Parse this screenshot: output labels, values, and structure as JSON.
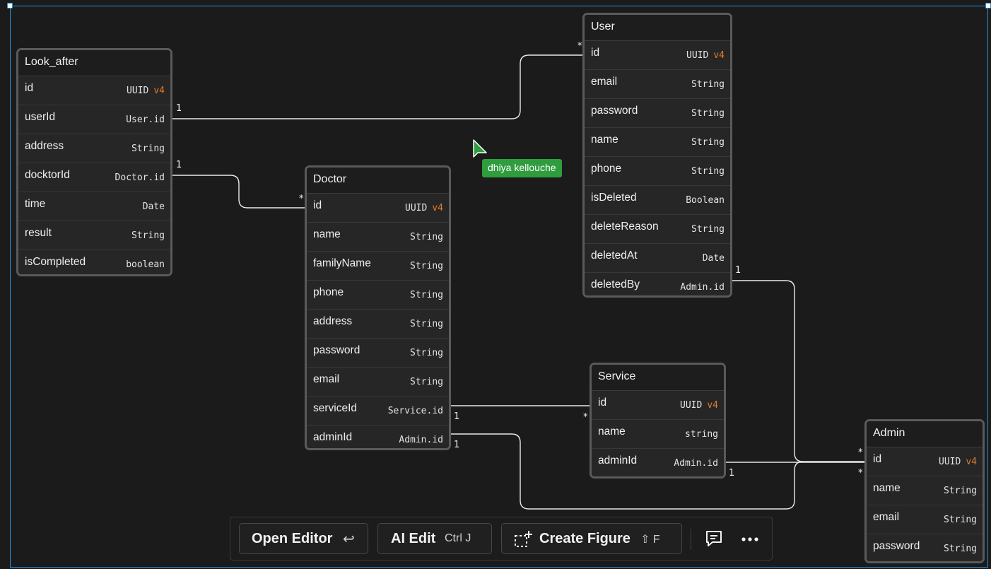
{
  "canvas": {
    "background": "#1b1b1b",
    "selection_color": "#2b8fd6",
    "wire_color": "#e9e9e9",
    "type_modifier_color": "#e07b2c"
  },
  "entities": {
    "look_after": {
      "title": "Look_after",
      "fields": [
        {
          "name": "id",
          "type": "UUID",
          "mod": "v4"
        },
        {
          "name": "userId",
          "type": "User.id",
          "mod": ""
        },
        {
          "name": "address",
          "type": "String",
          "mod": ""
        },
        {
          "name": "docktorId",
          "type": "Doctor.id",
          "mod": ""
        },
        {
          "name": "time",
          "type": "Date",
          "mod": ""
        },
        {
          "name": "result",
          "type": "String",
          "mod": ""
        },
        {
          "name": "isCompleted",
          "type": "boolean",
          "mod": ""
        }
      ]
    },
    "user": {
      "title": "User",
      "fields": [
        {
          "name": "id",
          "type": "UUID",
          "mod": "v4"
        },
        {
          "name": "email",
          "type": "String",
          "mod": ""
        },
        {
          "name": "password",
          "type": "String",
          "mod": ""
        },
        {
          "name": "name",
          "type": "String",
          "mod": ""
        },
        {
          "name": "phone",
          "type": "String",
          "mod": ""
        },
        {
          "name": "isDeleted",
          "type": "Boolean",
          "mod": ""
        },
        {
          "name": "deleteReason",
          "type": "String",
          "mod": ""
        },
        {
          "name": "deletedAt",
          "type": "Date",
          "mod": ""
        },
        {
          "name": "deletedBy",
          "type": "Admin.id",
          "mod": ""
        }
      ]
    },
    "doctor": {
      "title": "Doctor",
      "fields": [
        {
          "name": "id",
          "type": "UUID",
          "mod": "v4"
        },
        {
          "name": "name",
          "type": "String",
          "mod": ""
        },
        {
          "name": "familyName",
          "type": "String",
          "mod": ""
        },
        {
          "name": "phone",
          "type": "String",
          "mod": ""
        },
        {
          "name": "address",
          "type": "String",
          "mod": ""
        },
        {
          "name": "password",
          "type": "String",
          "mod": ""
        },
        {
          "name": "email",
          "type": "String",
          "mod": ""
        },
        {
          "name": "serviceId",
          "type": "Service.id",
          "mod": ""
        },
        {
          "name": "adminId",
          "type": "Admin.id",
          "mod": ""
        }
      ]
    },
    "service": {
      "title": "Service",
      "fields": [
        {
          "name": "id",
          "type": "UUID",
          "mod": "v4"
        },
        {
          "name": "name",
          "type": "string",
          "mod": ""
        },
        {
          "name": "adminId",
          "type": "Admin.id",
          "mod": ""
        }
      ]
    },
    "admin": {
      "title": "Admin",
      "fields": [
        {
          "name": "id",
          "type": "UUID",
          "mod": "v4"
        },
        {
          "name": "name",
          "type": "String",
          "mod": ""
        },
        {
          "name": "email",
          "type": "String",
          "mod": ""
        },
        {
          "name": "password",
          "type": "String",
          "mod": ""
        }
      ]
    }
  },
  "relations": [
    {
      "from": "Look_after.userId",
      "to": "User.id",
      "from_card": "1",
      "to_card": "*"
    },
    {
      "from": "Look_after.docktorId",
      "to": "Doctor.id",
      "from_card": "1",
      "to_card": "*"
    },
    {
      "from": "Doctor.serviceId",
      "to": "Service.id",
      "from_card": "1",
      "to_card": "*"
    },
    {
      "from": "Doctor.adminId",
      "to": "Admin.id",
      "from_card": "1",
      "to_card": "*"
    },
    {
      "from": "User.deletedBy",
      "to": "Admin.id",
      "from_card": "1",
      "to_card": "*"
    },
    {
      "from": "Service.adminId",
      "to": "Admin.id",
      "from_card": "1",
      "to_card": "*"
    }
  ],
  "collaborator": {
    "name": "dhiya kellouche",
    "color": "#2f9d3d"
  },
  "toolbar": {
    "open_editor": {
      "label": "Open Editor",
      "shortcut": "↩"
    },
    "ai_edit": {
      "label": "AI Edit",
      "shortcut": "Ctrl J"
    },
    "create_figure": {
      "label": "Create Figure",
      "shortcut": "⇧ F"
    },
    "icons": [
      "return-icon",
      "dashed-plus-icon",
      "comment-icon",
      "more-icon"
    ]
  }
}
